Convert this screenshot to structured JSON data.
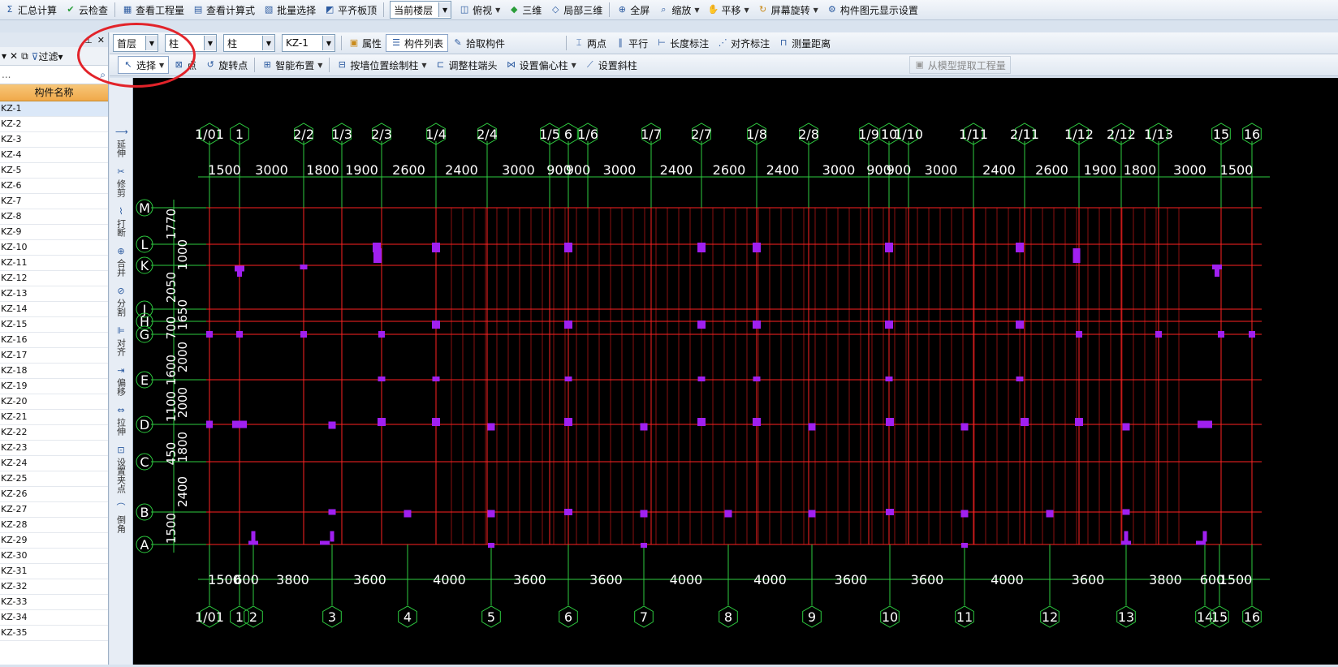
{
  "toolbar1": {
    "items": [
      "汇总计算",
      "云检查",
      "查看工程量",
      "查看计算式",
      "批量选择",
      "平齐板顶"
    ],
    "floor_select": "当前楼层",
    "view_items": [
      "俯视",
      "三维",
      "局部三维",
      "全屏",
      "缩放",
      "平移",
      "屏幕旋转",
      "构件图元显示设置"
    ]
  },
  "toolbar2": {
    "floor": "首层",
    "category": "柱",
    "type": "柱",
    "component": "KZ-1",
    "buttons": [
      "属性",
      "构件列表",
      "拾取构件"
    ],
    "measure": [
      "两点",
      "平行",
      "长度标注",
      "对齐标注",
      "测量距离"
    ]
  },
  "toolbar3": {
    "items": [
      "选择",
      "点",
      "旋转点",
      "智能布置",
      "按墙位置绘制柱",
      "调整柱端头",
      "设置偏心柱",
      "设置斜柱"
    ],
    "extract": "从模型提取工程量"
  },
  "left_panel": {
    "filter_label": "过滤",
    "search_placeholder": "...",
    "column_header": "构件名称",
    "items": [
      "KZ-1",
      "KZ-2",
      "KZ-3",
      "KZ-4",
      "KZ-5",
      "KZ-6",
      "KZ-7",
      "KZ-8",
      "KZ-9",
      "KZ-10",
      "KZ-11",
      "KZ-12",
      "KZ-13",
      "KZ-14",
      "KZ-15",
      "KZ-16",
      "KZ-17",
      "KZ-18",
      "KZ-19",
      "KZ-20",
      "KZ-21",
      "KZ-22",
      "KZ-23",
      "KZ-24",
      "KZ-25",
      "KZ-26",
      "KZ-27",
      "KZ-28",
      "KZ-29",
      "KZ-30",
      "KZ-31",
      "KZ-32",
      "KZ-33",
      "KZ-34",
      "KZ-35"
    ]
  },
  "vertical_tools": [
    "延伸",
    "修剪",
    "打断",
    "合并",
    "分割",
    "对齐",
    "偏移",
    "拉伸",
    "设置夹点",
    "倒角"
  ],
  "drawing": {
    "top_axes": [
      "1/01",
      "1",
      "2/2",
      "1/3",
      "2/3",
      "1/4",
      "2/4",
      "1/5",
      "6",
      "1/6",
      "1/7",
      "2/7",
      "1/8",
      "2/8",
      "1/9",
      "10",
      "1/10",
      "1/11",
      "2/11",
      "1/12",
      "2/12",
      "1/13",
      "15",
      "16"
    ],
    "top_dims": [
      "1500",
      "3000",
      "1800",
      "1900",
      "2600",
      "2400",
      "3000",
      "900",
      "900",
      "3000",
      "2400",
      "2600",
      "2400",
      "3000",
      "900",
      "900",
      "3000",
      "2400",
      "2600",
      "1900",
      "1800",
      "3000",
      "1500"
    ],
    "bottom_axes": [
      "1/01",
      "1",
      "2",
      "3",
      "4",
      "5",
      "6",
      "7",
      "8",
      "9",
      "10",
      "11",
      "12",
      "13",
      "14",
      "15",
      "16"
    ],
    "bottom_dims": [
      "1500",
      "600",
      "3800",
      "3600",
      "4000",
      "3600",
      "3600",
      "4000",
      "4000",
      "3600",
      "3600",
      "4000",
      "3600",
      "3800",
      "600",
      "1500"
    ],
    "left_axes": [
      "M",
      "L",
      "K",
      "J",
      "H",
      "G",
      "E",
      "D",
      "C",
      "B",
      "A"
    ],
    "left_dims": [
      "1770",
      "1000",
      "2050",
      "1650",
      "700",
      "2000",
      "1600",
      "2000",
      "1100",
      "1800",
      "450",
      "2400",
      "1500"
    ],
    "colors": {
      "background": "#000000",
      "grid": "#ff2222",
      "axis": "#2ecc40",
      "column": "#a020f0",
      "text": "#ffffff"
    }
  },
  "annotation": {
    "color": "#e2232a",
    "shape": "ellipse"
  }
}
